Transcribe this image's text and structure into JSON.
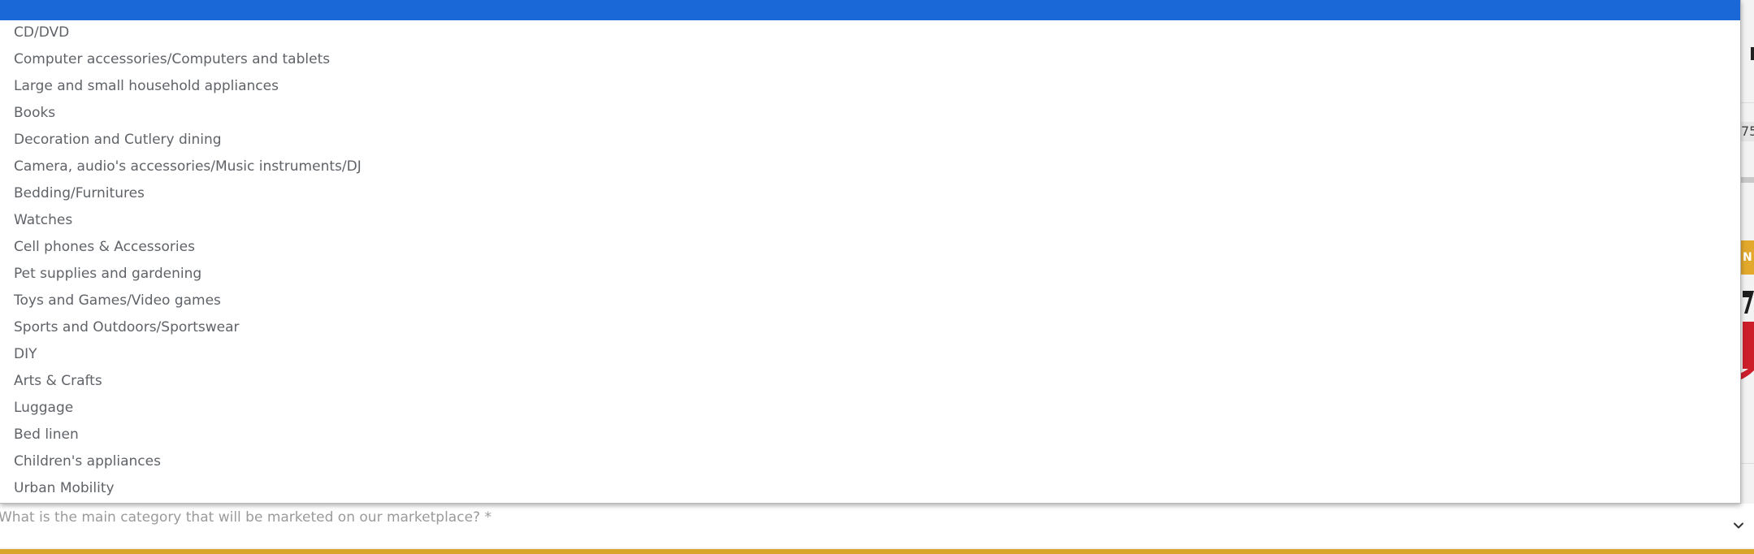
{
  "background": {
    "input_fragment_text": "75",
    "button_fragment_text": "N"
  },
  "dropdown": {
    "options": [
      "CD/DVD",
      "Computer accessories/Computers and tablets",
      "Large and small household appliances",
      "Books",
      "Decoration and Cutlery dining",
      "Camera, audio's accessories/Music instruments/DJ",
      "Bedding/Furnitures",
      "Watches",
      "Cell phones & Accessories",
      "Pet supplies and gardening",
      "Toys and Games/Video games",
      "Sports and Outdoors/Sportswear",
      "DIY",
      "Arts & Crafts",
      "Luggage",
      "Bed linen",
      "Children's appliances",
      "Urban Mobility"
    ]
  },
  "select": {
    "placeholder": "What is the main category that will be marketed on our marketplace? *",
    "chevron_icon": "chevron-down-icon"
  },
  "colors": {
    "highlight": "#1a68d8",
    "accent": "#d9a42a"
  }
}
